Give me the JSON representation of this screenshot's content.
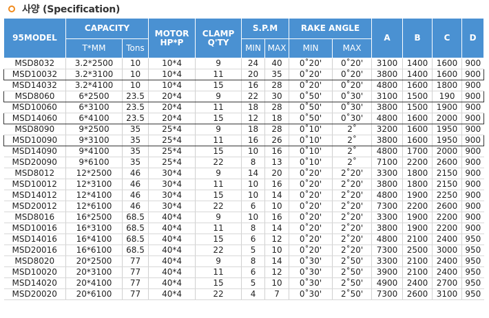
{
  "section": {
    "title": "사양 (Specification)"
  },
  "headers": {
    "model": "95MODEL",
    "capacity": "CAPACITY",
    "capacity_tmm": "T*MM",
    "capacity_tons": "Tons",
    "motor": "MOTOR HP*P",
    "clamp": "CLAMP Q'TY",
    "spm": "S.P.M",
    "spm_min": "MIN",
    "spm_max": "MAX",
    "rake": "RAKE ANGLE",
    "rake_min": "MIN",
    "rake_max": "MAX",
    "a": "A",
    "b": "B",
    "c": "C",
    "d": "D"
  },
  "rows": [
    [
      "MSD8032",
      "3.2*2500",
      "10",
      "10*4",
      "9",
      "24",
      "40",
      "0˚20'",
      "0˚20'",
      "3100",
      "1400",
      "1600",
      "900"
    ],
    [
      "MSD10032",
      "3.2*3100",
      "10",
      "10*4",
      "11",
      "20",
      "35",
      "0˚20'",
      "0˚20'",
      "3800",
      "1400",
      "1600",
      "900"
    ],
    [
      "MSD14032",
      "3.2*4100",
      "10",
      "10*4",
      "15",
      "16",
      "28",
      "0˚20'",
      "0˚20'",
      "4800",
      "1600",
      "1800",
      "900"
    ],
    [
      "MSD8060",
      "6*2500",
      "23.5",
      "20*4",
      "9",
      "22",
      "30",
      "0˚50'",
      "0˚30'",
      "3100",
      "1500",
      "190",
      "900"
    ],
    [
      "MSD10060",
      "6*3100",
      "23.5",
      "20*4",
      "11",
      "18",
      "28",
      "0˚50'",
      "0˚30'",
      "3800",
      "1500",
      "1900",
      "900"
    ],
    [
      "MSD14060",
      "6*4100",
      "23.5",
      "20*4",
      "15",
      "12",
      "18",
      "0˚50'",
      "0˚30'",
      "4800",
      "1600",
      "2000",
      "900"
    ],
    [
      "MSD8090",
      "9*2500",
      "35",
      "25*4",
      "9",
      "18",
      "28",
      "0˚10'",
      "2˚",
      "3200",
      "1600",
      "1950",
      "900"
    ],
    [
      "MSD10090",
      "9*3100",
      "35",
      "25*4",
      "11",
      "16",
      "26",
      "0˚10'",
      "2˚",
      "3800",
      "1600",
      "1950",
      "900"
    ],
    [
      "MSD14090",
      "9*4100",
      "35",
      "25*4",
      "15",
      "10",
      "16",
      "0˚10'",
      "2˚",
      "4800",
      "1700",
      "2000",
      "900"
    ],
    [
      "MSD20090",
      "9*6100",
      "35",
      "25*4",
      "22",
      "8",
      "13",
      "0˚10'",
      "2˚",
      "7100",
      "2200",
      "2600",
      "900"
    ],
    [
      "MSD8012",
      "12*2500",
      "46",
      "30*4",
      "9",
      "14",
      "20",
      "0˚20'",
      "2˚20'",
      "3300",
      "1800",
      "2150",
      "900"
    ],
    [
      "MSD10012",
      "12*3100",
      "46",
      "30*4",
      "11",
      "10",
      "16",
      "0˚20'",
      "2˚20'",
      "3800",
      "1800",
      "2150",
      "900"
    ],
    [
      "MSD14012",
      "12*4100",
      "46",
      "30*4",
      "15",
      "10",
      "14",
      "0˚20'",
      "2˚20'",
      "4800",
      "1900",
      "2250",
      "900"
    ],
    [
      "MSD20012",
      "12*6100",
      "46",
      "30*4",
      "22",
      "6",
      "10",
      "0˚20'",
      "2˚20'",
      "7300",
      "2200",
      "2600",
      "900"
    ],
    [
      "MSD8016",
      "16*2500",
      "68.5",
      "40*4",
      "9",
      "10",
      "16",
      "0˚20'",
      "2˚20'",
      "3300",
      "1900",
      "2200",
      "900"
    ],
    [
      "MSD10016",
      "16*3100",
      "68.5",
      "40*4",
      "11",
      "8",
      "14",
      "0˚20'",
      "2˚20'",
      "3800",
      "1900",
      "2200",
      "900"
    ],
    [
      "MSD14016",
      "16*4100",
      "68.5",
      "40*4",
      "15",
      "6",
      "12",
      "0˚20'",
      "2˚20'",
      "4800",
      "2100",
      "2400",
      "950"
    ],
    [
      "MSD20016",
      "16*6100",
      "68.5",
      "40*4",
      "22",
      "5",
      "10",
      "0˚20'",
      "2˚20'",
      "7300",
      "2500",
      "3000",
      "950"
    ],
    [
      "MSD8020",
      "20*2500",
      "77",
      "40*4",
      "9",
      "8",
      "14",
      "0˚30'",
      "2˚50'",
      "3300",
      "2100",
      "2400",
      "950"
    ],
    [
      "MSD10020",
      "20*3100",
      "77",
      "40*4",
      "11",
      "6",
      "12",
      "0˚30'",
      "2˚50'",
      "3900",
      "2100",
      "2400",
      "950"
    ],
    [
      "MSD14020",
      "20*4100",
      "77",
      "40*4",
      "15",
      "5",
      "10",
      "0˚30'",
      "2˚50'",
      "4900",
      "2400",
      "2700",
      "950"
    ],
    [
      "MSD20020",
      "20*6100",
      "77",
      "40*4",
      "22",
      "4",
      "7",
      "0˚30'",
      "2˚50'",
      "7300",
      "2600",
      "3100",
      "950"
    ]
  ],
  "highlighted_models": [
    "MSD10032",
    "MSD8060",
    "MSD14060",
    "MSD10090"
  ],
  "colors": {
    "header_bg": "#4a91d2",
    "bullet": "#f08a1c"
  }
}
